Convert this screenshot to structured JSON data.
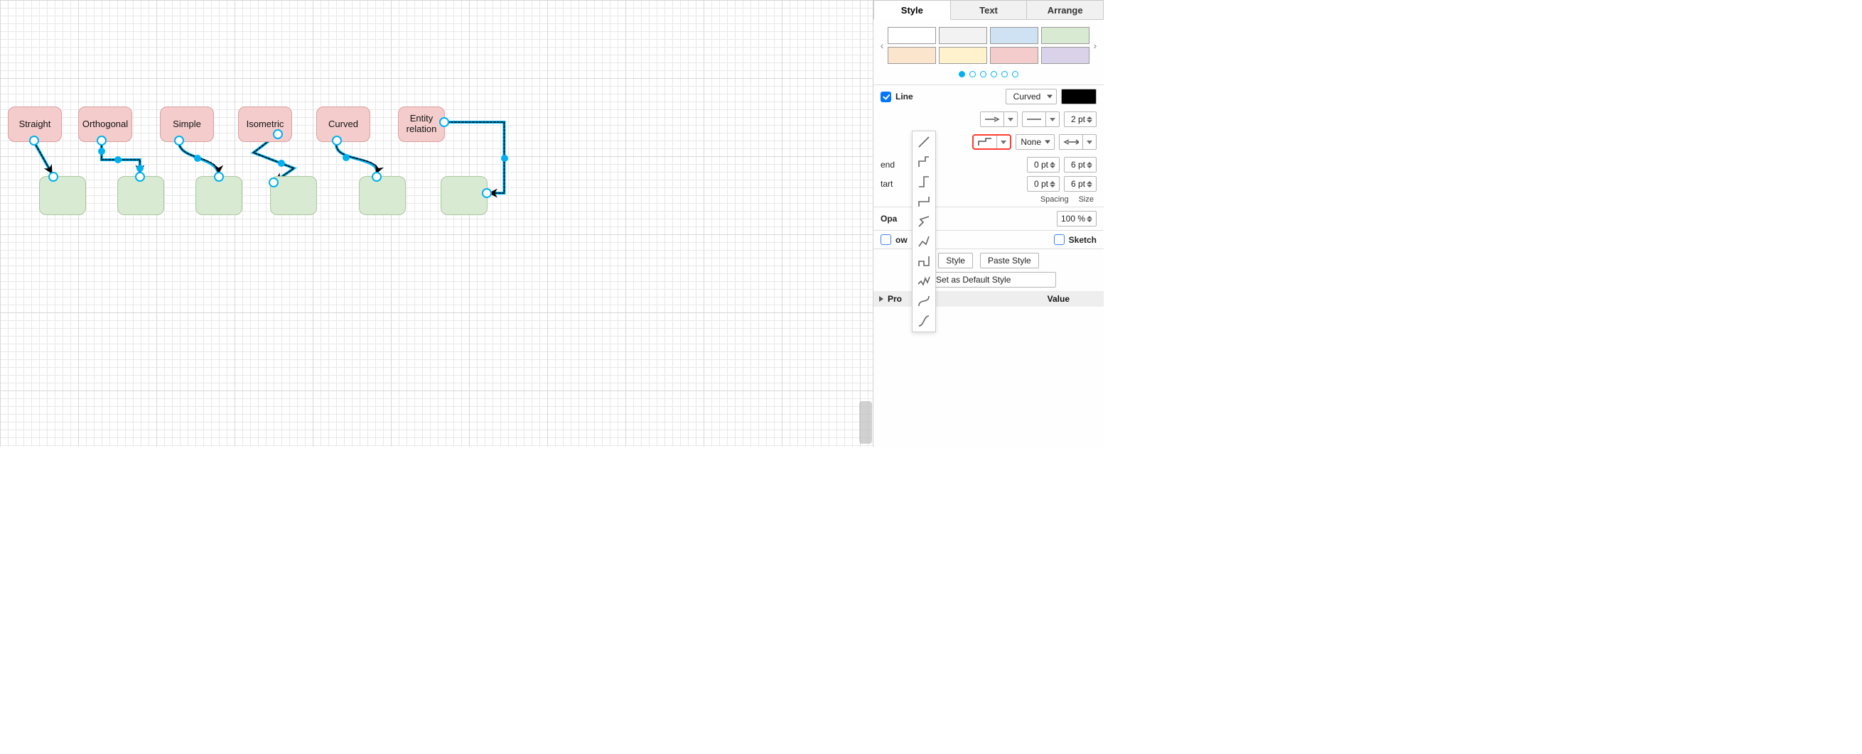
{
  "canvas": {
    "nodes": {
      "straight": {
        "label": "Straight"
      },
      "orthogonal": {
        "label": "Orthogonal"
      },
      "simple": {
        "label": "Simple"
      },
      "isometric": {
        "label": "Isometric"
      },
      "curved": {
        "label": "Curved"
      },
      "entity": {
        "label": "Entity\nrelation"
      }
    }
  },
  "panel": {
    "tabs": {
      "style": "Style",
      "text": "Text",
      "arrange": "Arrange"
    },
    "swatches": {
      "row1": [
        "#ffffff",
        "#f2f2f2",
        "#cfe2f3",
        "#d9ead3"
      ],
      "row2": [
        "#fce5cd",
        "#fff2cc",
        "#f4cccc",
        "#d9d2e9"
      ]
    },
    "line": {
      "label": "Line",
      "checked": true,
      "style_select": "Curved",
      "color": "#000000",
      "width_value": "2 pt",
      "none_label": "None",
      "end_label": "end",
      "start_label": "tart",
      "spacing_label": "Spacing",
      "size_label": "Size",
      "end_spacing": "0 pt",
      "end_size": "6 pt",
      "start_spacing": "0 pt",
      "start_size": "6 pt"
    },
    "opacity": {
      "label_fragment": "Opa",
      "value": "100 %"
    },
    "shadow": {
      "checkbox_checked": false,
      "label_fragment": "ow",
      "sketch_label": "Sketch",
      "sketch_checked": false
    },
    "buttons": {
      "copy_style_fragment": "Style",
      "paste_style": "Paste Style",
      "default_style_fragment": "Set as Default Style"
    },
    "properties": {
      "header_fragment": "Pro",
      "value_header": "Value"
    }
  },
  "chart_data": null
}
